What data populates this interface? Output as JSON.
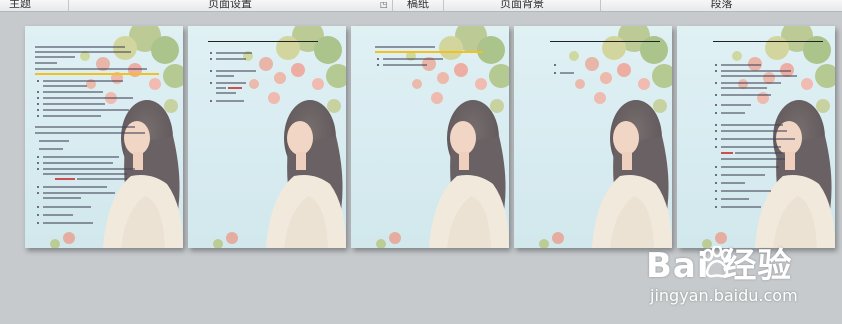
{
  "ribbon": {
    "groups": [
      {
        "label": "主题"
      },
      {
        "label": "页面设置"
      },
      {
        "label": "稿纸"
      },
      {
        "label": "页面背景"
      },
      {
        "label": "段落"
      }
    ],
    "launcher_icon": "dialog-launcher-icon"
  },
  "pages": [
    {
      "name": "page-1",
      "has_text": true
    },
    {
      "name": "page-2",
      "has_text": true
    },
    {
      "name": "page-3",
      "has_text": true
    },
    {
      "name": "page-4",
      "has_text": true
    },
    {
      "name": "page-5",
      "has_text": true
    }
  ],
  "background_image": "woman-with-flowers-photo",
  "watermark": {
    "brand": "Bai  经验",
    "url": "jingyan.baidu.com",
    "logo_icon": "baidu-paw-icon"
  },
  "colors": {
    "canvas": "#c6cacd",
    "highlight": "#f3c11d",
    "sky": "#d6e9ee"
  }
}
